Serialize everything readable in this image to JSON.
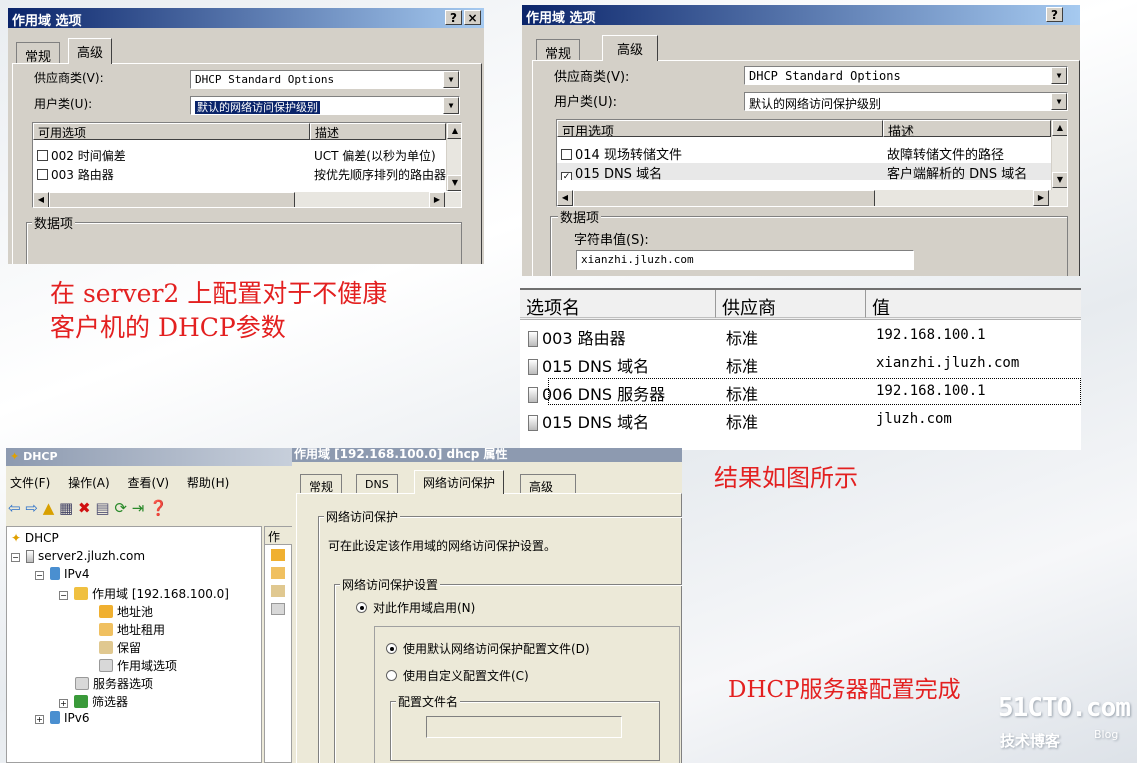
{
  "dialog1": {
    "title": "作用域 选项",
    "help_btn": "?",
    "close_btn": "×",
    "tab_general": "常规",
    "tab_advanced": "高级",
    "vendor_label": "供应商类(V):",
    "vendor_value": "DHCP Standard Options",
    "user_label": "用户类(U):",
    "user_value": "默认的网络访问保护级别",
    "col_options": "可用选项",
    "col_desc": "描述",
    "rows": [
      {
        "name": "002 时间偏差",
        "desc": "UCT 偏差(以秒为单位)",
        "checked": false
      },
      {
        "name": "003 路由器",
        "desc": "按优先顺序排列的路由器",
        "checked": false
      }
    ],
    "data_group": "数据项"
  },
  "dialog2": {
    "title": "作用域 选项",
    "help_btn": "?",
    "tab_general": "常规",
    "tab_advanced": "高级",
    "vendor_label": "供应商类(V):",
    "vendor_value": "DHCP Standard Options",
    "user_label": "用户类(U):",
    "user_value": "默认的网络访问保护级别",
    "col_options": "可用选项",
    "col_desc": "描述",
    "rows": [
      {
        "name": "014 现场转储文件",
        "desc": "故障转储文件的路径",
        "checked": false
      },
      {
        "name": "015 DNS 域名",
        "desc": "客户端解析的 DNS 域名",
        "checked": true
      }
    ],
    "data_group": "数据项",
    "string_label": "字符串值(S):",
    "string_value": "xianzhi.jluzh.com"
  },
  "caption1_line1": "在 server2 上配置对于不健康",
  "caption1_line2": "客户机的 DHCP参数",
  "result_table": {
    "headers": [
      "选项名",
      "供应商",
      "值"
    ],
    "rows": [
      {
        "name": "003 路由器",
        "vendor": "标准",
        "value": "192.168.100.1"
      },
      {
        "name": "015 DNS 域名",
        "vendor": "标准",
        "value": "xianzhi.jluzh.com"
      },
      {
        "name": "006 DNS 服务器",
        "vendor": "标准",
        "value": "192.168.100.1"
      },
      {
        "name": "015 DNS 域名",
        "vendor": "标准",
        "value": "jluzh.com"
      }
    ]
  },
  "caption2": "结果如图所示",
  "dhcp_console": {
    "title": "DHCP",
    "menu": [
      "文件(F)",
      "操作(A)",
      "查看(V)",
      "帮助(H)"
    ],
    "tree": {
      "root": "DHCP",
      "server": "server2.jluzh.com",
      "ipv4": "IPv4",
      "scope": "作用域 [192.168.100.0]",
      "pool": "地址池",
      "leases": "地址租用",
      "reservations": "保留",
      "scope_options": "作用域选项",
      "server_options": "服务器选项",
      "filters": "筛选器",
      "ipv6": "IPv6"
    },
    "right_header": "作"
  },
  "nap_dialog": {
    "title": "作用域 [192.168.100.0] dhcp 属性",
    "tabs": [
      "常规",
      "DNS",
      "网络访问保护",
      "高级"
    ],
    "group_nap": "网络访问保护",
    "desc": "可在此设定该作用域的网络访问保护设置。",
    "group_settings": "网络访问保护设置",
    "enable_label": "对此作用域启用(N)",
    "opt_default": "使用默认网络访问保护配置文件(D)",
    "opt_custom": "使用自定义配置文件(C)",
    "profile_label": "配置文件名"
  },
  "caption3": "DHCP服务器配置完成",
  "watermark": {
    "main": "51CTO.com",
    "sub": "技术博客",
    "blog": "Blog"
  }
}
